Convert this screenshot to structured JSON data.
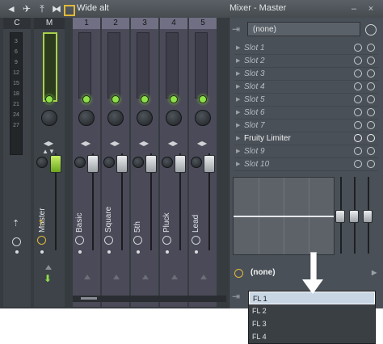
{
  "titlebar": {
    "preset": "Wide alt",
    "title": "Mixer - Master",
    "minimize": "–",
    "close": "×"
  },
  "strips": [
    {
      "id": "C",
      "name": ""
    },
    {
      "id": "M",
      "name": "Master"
    },
    {
      "id": "1",
      "name": "Basic"
    },
    {
      "id": "2",
      "name": "Square"
    },
    {
      "id": "3",
      "name": "5th"
    },
    {
      "id": "4",
      "name": "Pluck"
    },
    {
      "id": "5",
      "name": "Lead"
    }
  ],
  "meter_ticks": [
    "3",
    "6",
    "9",
    "12",
    "15",
    "18",
    "21",
    "24",
    "27"
  ],
  "inserts": {
    "input": "(none)",
    "slots": [
      "Slot 1",
      "Slot 2",
      "Slot 3",
      "Slot 4",
      "Slot 5",
      "Slot 6",
      "Slot 7",
      "Fruity Limiter",
      "Slot 9",
      "Slot 10"
    ],
    "active_slot": "Fruity Limiter",
    "output": "(none)"
  },
  "dropdown": {
    "items": [
      "FL 1",
      "FL 2",
      "FL 3",
      "FL 4"
    ],
    "selected": "FL 1"
  },
  "colors": {
    "led": "#8ee04a",
    "insert_header": "#716f84",
    "selection": "#c8d6e4"
  }
}
